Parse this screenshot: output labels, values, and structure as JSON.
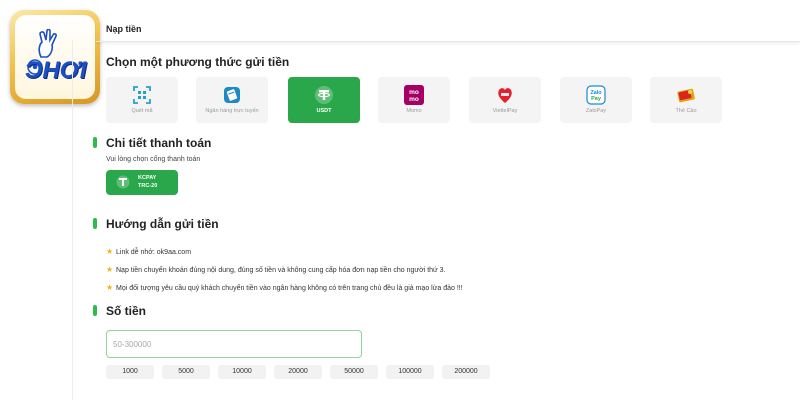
{
  "header": {
    "title": "Nạp tiền"
  },
  "logo": {
    "text": "ƆHƠI"
  },
  "methods_section": {
    "title": "Chọn một phương thức gửi tiền"
  },
  "methods": [
    {
      "label": "Quét mã",
      "icon": "qr-scan-icon",
      "active": false
    },
    {
      "label": "Ngân hàng trực tuyến",
      "icon": "online-bank-icon",
      "active": false
    },
    {
      "label": "USDT",
      "icon": "tether-icon",
      "active": true
    },
    {
      "label": "Momo",
      "icon": "momo-icon",
      "active": false
    },
    {
      "label": "ViettelPay",
      "icon": "viettelpay-icon",
      "active": false
    },
    {
      "label": "ZaloPay",
      "icon": "zalopay-icon",
      "active": false
    },
    {
      "label": "Thẻ Cào",
      "icon": "scratch-card-icon",
      "active": false
    }
  ],
  "payment_details": {
    "title": "Chi tiết thanh toán",
    "hint": "Vui lòng chọn cổng thanh toán",
    "gateway": {
      "line1": "KCPAY",
      "line2": "TRC-20",
      "icon": "tether-icon"
    }
  },
  "guide": {
    "title": "Hướng dẫn gửi tiền",
    "items": [
      "Link dễ nhớ: ok9aa.com",
      "Nạp tiền chuyển khoản đúng nội dung, đúng số tiền và không cung cấp hóa đơn nạp tiền cho người thứ 3.",
      "Mọi đối tượng yêu cầu quý khách chuyển tiền vào ngân hàng không có trên trang chủ đều là giả mạo lừa đảo !!!"
    ]
  },
  "amount": {
    "title": "Số tiền",
    "placeholder": "50-300000",
    "quick_amounts": [
      "1000",
      "5000",
      "10000",
      "20000",
      "50000",
      "100000",
      "200000"
    ]
  },
  "colors": {
    "accent": "#2aa74a",
    "section_bar": "#2dbb4e",
    "star": "#f2b21a",
    "logo_blue": "#1d4fc4"
  }
}
